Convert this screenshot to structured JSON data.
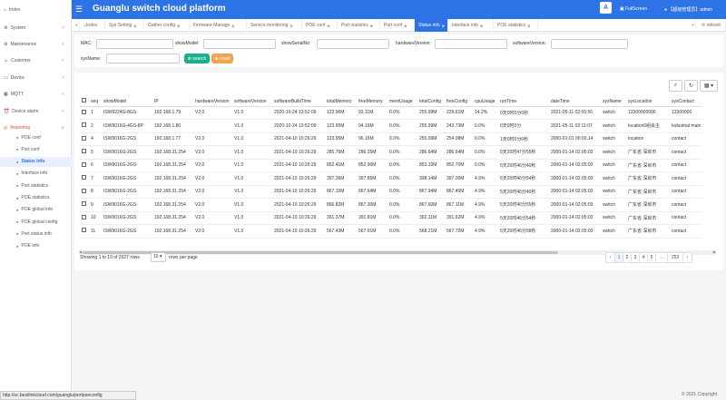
{
  "app": {
    "title": "Guanglu switch cloud platform",
    "fullscreen_label": "FullScreen",
    "user_label": "【超级管理员】admin",
    "translate_label": "A"
  },
  "sidebar": {
    "items": [
      {
        "label": "Index",
        "icon": "⌂",
        "chevron": ""
      },
      {
        "label": "System",
        "icon": "⚙",
        "chevron": "<"
      },
      {
        "label": "Maintenance",
        "icon": "⚙",
        "chevron": "<"
      },
      {
        "label": "Customer",
        "icon": "☺",
        "chevron": "<"
      },
      {
        "label": "Device",
        "icon": "▭",
        "chevron": "<"
      },
      {
        "label": "MQTT",
        "icon": "▦",
        "chevron": "<"
      },
      {
        "label": "Device alarm",
        "icon": "⏰",
        "chevron": "<"
      },
      {
        "label": "Reporting",
        "icon": "◎",
        "chevron": "∨"
      }
    ],
    "subitems": [
      {
        "label": "POE conf"
      },
      {
        "label": "Port conf"
      },
      {
        "label": "Status info"
      },
      {
        "label": "Interface info"
      },
      {
        "label": "Port statistics"
      },
      {
        "label": "POE statistics"
      },
      {
        "label": "POE global info"
      },
      {
        "label": "POE global config"
      },
      {
        "label": "Port status info"
      },
      {
        "label": "POE info"
      }
    ]
  },
  "tabs": [
    {
      "label": "Index"
    },
    {
      "label": "Sys Setting"
    },
    {
      "label": "Gather config"
    },
    {
      "label": "Firmware Manage"
    },
    {
      "label": "Service monitoring"
    },
    {
      "label": "POE conf"
    },
    {
      "label": "Port statistics"
    },
    {
      "label": "Port conf"
    },
    {
      "label": "Status info"
    },
    {
      "label": "Interface info"
    },
    {
      "label": "POE statistics"
    }
  ],
  "tab_nav": {
    "left": "«",
    "right": "»",
    "refresh": "⟳ refresh"
  },
  "search": {
    "mac_label": "MAC:",
    "show_model_label": "showModel:",
    "show_serial_label": "showSerialNo:",
    "hardware_label": "hardwareVersion:",
    "software_label": "softwareVersion:",
    "sysname_label": "sysName:",
    "search_btn": "⊕ search",
    "reset_btn": "⊕ reset"
  },
  "toolbar": {
    "search_icon": "⌕",
    "refresh_icon": "↻",
    "columns_icon": "▦ ▾"
  },
  "table": {
    "headers": [
      "seq",
      "showModel",
      "IP",
      "hardwareVersion",
      "softwareVersion",
      "softwareBuildTime",
      "totalMemory",
      "freeMemory",
      "memUsage",
      "totalConfig",
      "freeConfig",
      "cpuUsage",
      "runTime",
      "dateTime",
      "sysName",
      "sysLocation",
      "sysContact"
    ],
    "rows": [
      [
        "1",
        "ISW9224G-8GS",
        "192.168.1.79",
        "V2.0",
        "V1.0",
        "2020-10-24 13:52:09",
        "123.96M",
        "93.11M",
        "0.0%",
        "255.99M",
        "229.61M",
        "14.2%",
        "0天0时0分0秒",
        "2021-05-11 02:05:56",
        "switch",
        "13300000000",
        "13300000"
      ],
      [
        "2",
        "ISW9016G-4GS-8P",
        "192.168.1.80",
        "",
        "V1.0",
        "2020-10-24 13:52:09",
        "123.95M",
        "94.16M",
        "0.0%",
        "255.99M",
        "243.73M",
        "0.0%",
        "0天0时0分",
        "2021-05-11 02:11:07",
        "switch",
        "location0组会主",
        "lodustrial main"
      ],
      [
        "4",
        "ISW9016G-2GS",
        "192.168.1.77",
        "V2.0",
        "V1.0",
        "2021-04-10 10:26:29",
        "123.95M",
        "96.15M",
        "0.0%",
        "255.99M",
        "254.08M",
        "0.0%",
        "1天0时0分0秒",
        "2000-01-01 00:00.14",
        "switch",
        "location",
        "contact"
      ],
      [
        "5",
        "ISW9016G-2GS",
        "192.168.31.254",
        "V2.0",
        "V1.0",
        "2021-04-10 10:26:29",
        "285.76M",
        "286.25M",
        "0.0%",
        "286.64M",
        "286.64M",
        "0.0%",
        "5天20时47分55秒",
        "2000-01-14 02:05:03",
        "switch",
        "广东省 深圳市",
        "contact"
      ],
      [
        "6",
        "ISW9016G-2GS",
        "192.168.31.254",
        "V2.0",
        "V1.0",
        "2021-04-10 10:26:29",
        "852.41M",
        "852.90M",
        "0.0%",
        "853.19M",
        "852.70M",
        "0.0%",
        "5天20时46分40秒",
        "2000-01-14 02:05:03",
        "switch",
        "广东省 深圳市",
        "contact"
      ],
      [
        "7",
        "ISW9016G-2GS",
        "192.168.31.254",
        "V2.0",
        "V1.0",
        "2021-04-10 10:26:29",
        "397.36M",
        "397.85M",
        "0.0%",
        "398.14M",
        "397.00M",
        "4.9%",
        "5天20时46分54秒",
        "2000-01-14 02:05:03",
        "switch",
        "广东省 深圳市",
        "contact"
      ],
      [
        "8",
        "ISW9016G-2GS",
        "192.168.31.254",
        "V2.0",
        "V1.0",
        "2021-04-10 10:26:29",
        "867.15M",
        "867.64M",
        "0.0%",
        "867.94M",
        "867.45M",
        "4.9%",
        "5天20时46分40秒",
        "2000-01-14 02:05:03",
        "switch",
        "广东省 深圳市",
        "contact"
      ],
      [
        "9",
        "ISW9016G-2GS",
        "192.168.31.254",
        "V2.0",
        "V1.0",
        "2021-04-10 10:26:29",
        "866.82M",
        "867.30M",
        "0.0%",
        "867.60M",
        "867.11M",
        "4.9%",
        "5天20时46分55秒",
        "2000-01-14 02:05:03",
        "switch",
        "广东省 深圳市",
        "contact"
      ],
      [
        "10",
        "ISW9016G-2GS",
        "192.168.31.254",
        "V2.0",
        "V1.0",
        "2021-04-10 10:26:29",
        "391.37M",
        "391.81M",
        "0.0%",
        "392.11M",
        "391.62M",
        "4.9%",
        "5天20时46分54秒",
        "2000-01-14 02:05:03",
        "switch",
        "广东省 深圳市",
        "contact"
      ],
      [
        "11",
        "ISW9016G-2GS",
        "192.168.31.254",
        "V2.0",
        "V1.0",
        "2021-04-10 10:26:29",
        "567.43M",
        "567.91M",
        "0.0%",
        "568.21M",
        "567.72M",
        "4.9%",
        "5天20时46分58秒",
        "2000-01-14 02:05:03",
        "switch",
        "广东省 深圳市",
        "contact"
      ]
    ]
  },
  "pagination": {
    "info": "Showing 1 to 10 of 2527 rows",
    "page_size": "10",
    "rows_per_page": "rows per page",
    "pages": [
      "‹",
      "1",
      "2",
      "3",
      "4",
      "5",
      "...",
      "253",
      "›"
    ]
  },
  "status_url": "http://sc.bestlinkcloud.com/guanglu/portpoeconfig",
  "copyright": "© 2021 Copyright"
}
